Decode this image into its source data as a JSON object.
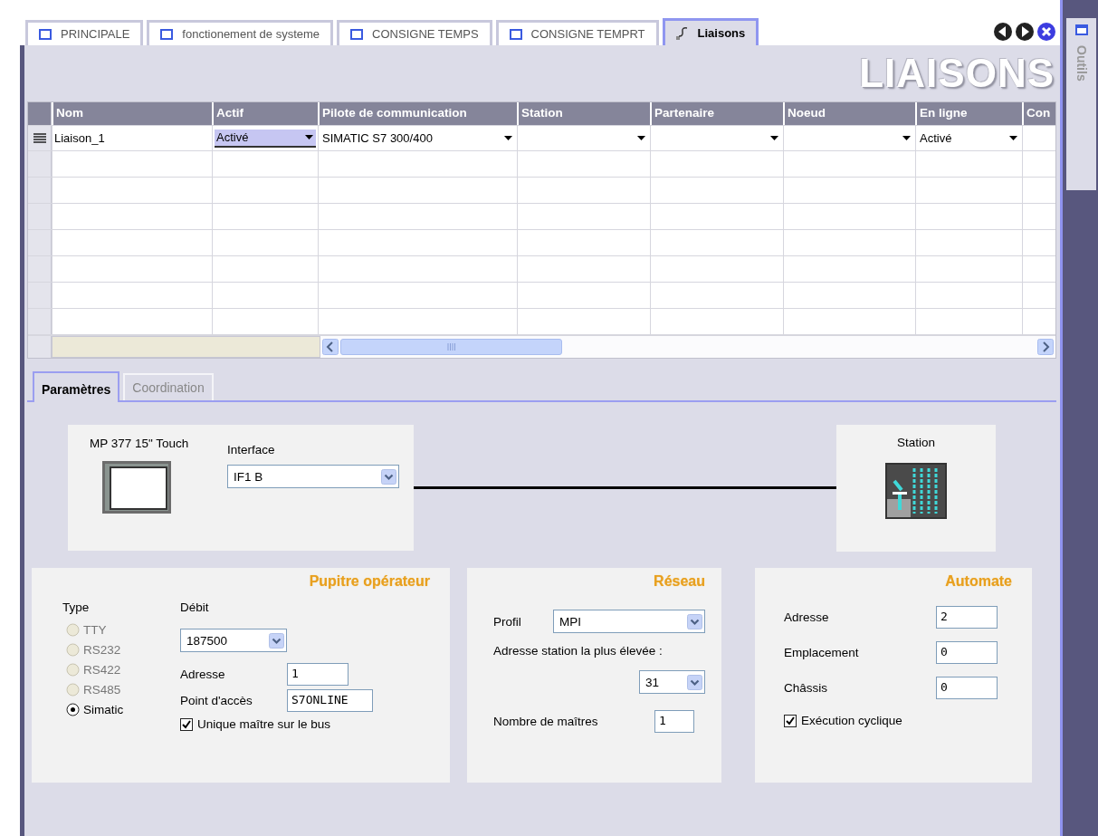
{
  "tabs": [
    {
      "label": "PRINCIPALE",
      "selected": false,
      "kind": "screen"
    },
    {
      "label": "fonctionement de systeme",
      "selected": false,
      "kind": "screen"
    },
    {
      "label": "CONSIGNE TEMPS",
      "selected": false,
      "kind": "screen"
    },
    {
      "label": "CONSIGNE TEMPRT",
      "selected": false,
      "kind": "screen"
    },
    {
      "label": "Liaisons",
      "selected": true,
      "kind": "connections"
    }
  ],
  "side_panel": {
    "label": "Outils"
  },
  "page_title": "LIAISONS",
  "table": {
    "columns": [
      "Nom",
      "Actif",
      "Pilote de communication",
      "Station",
      "Partenaire",
      "Noeud",
      "En ligne",
      "Con"
    ],
    "rows": [
      {
        "cells": [
          {
            "kind": "text",
            "value": "Liaison_1",
            "selected": false
          },
          {
            "kind": "dropdown",
            "value": "Activé",
            "selected": true
          },
          {
            "kind": "dropdown",
            "value": "SIMATIC S7 300/400",
            "selected": false
          },
          {
            "kind": "dropdown",
            "selected": false
          },
          {
            "kind": "dropdown",
            "selected": false
          },
          {
            "kind": "dropdown",
            "selected": false
          },
          {
            "kind": "dropdown",
            "value": "Activé",
            "selected": false
          },
          {
            "kind": "text",
            "selected": false
          }
        ]
      }
    ]
  },
  "detail_tabs": [
    {
      "label": "Paramètres",
      "selected": true
    },
    {
      "label": "Coordination",
      "selected": false
    }
  ],
  "diagram": {
    "device": {
      "name": "MP 377 15\" Touch",
      "interface_label": "Interface",
      "interface_value": "IF1 B"
    },
    "station": {
      "name": "Station"
    }
  },
  "pupitre": {
    "title": "Pupitre opérateur",
    "type_label": "Type",
    "types": [
      {
        "label": "TTY",
        "selected": false,
        "disabled": true
      },
      {
        "label": "RS232",
        "selected": false,
        "disabled": true
      },
      {
        "label": "RS422",
        "selected": false,
        "disabled": true
      },
      {
        "label": "RS485",
        "selected": false,
        "disabled": true
      },
      {
        "label": "Simatic",
        "selected": true,
        "disabled": false
      }
    ],
    "debit_label": "Débit",
    "debit": "187500",
    "fields": [
      {
        "label": "Adresse",
        "value": "1"
      },
      {
        "label": "Point d'accès",
        "value": "S7ONLINE"
      }
    ],
    "checkbox": {
      "label": "Unique maître sur le bus",
      "checked": true
    }
  },
  "reseau": {
    "title": "Réseau",
    "profil_label": "Profil",
    "profil": "MPI",
    "highest_label": "Adresse station la plus élevée :",
    "highest": "31",
    "masters_label": "Nombre de maîtres",
    "masters": "1"
  },
  "automate": {
    "title": "Automate",
    "fields": [
      {
        "label": "Adresse",
        "value": "2"
      },
      {
        "label": "Emplacement",
        "value": "0"
      },
      {
        "label": "Châssis",
        "value": "0"
      }
    ],
    "checkbox": {
      "label": "Exécution cyclique",
      "checked": true
    }
  }
}
